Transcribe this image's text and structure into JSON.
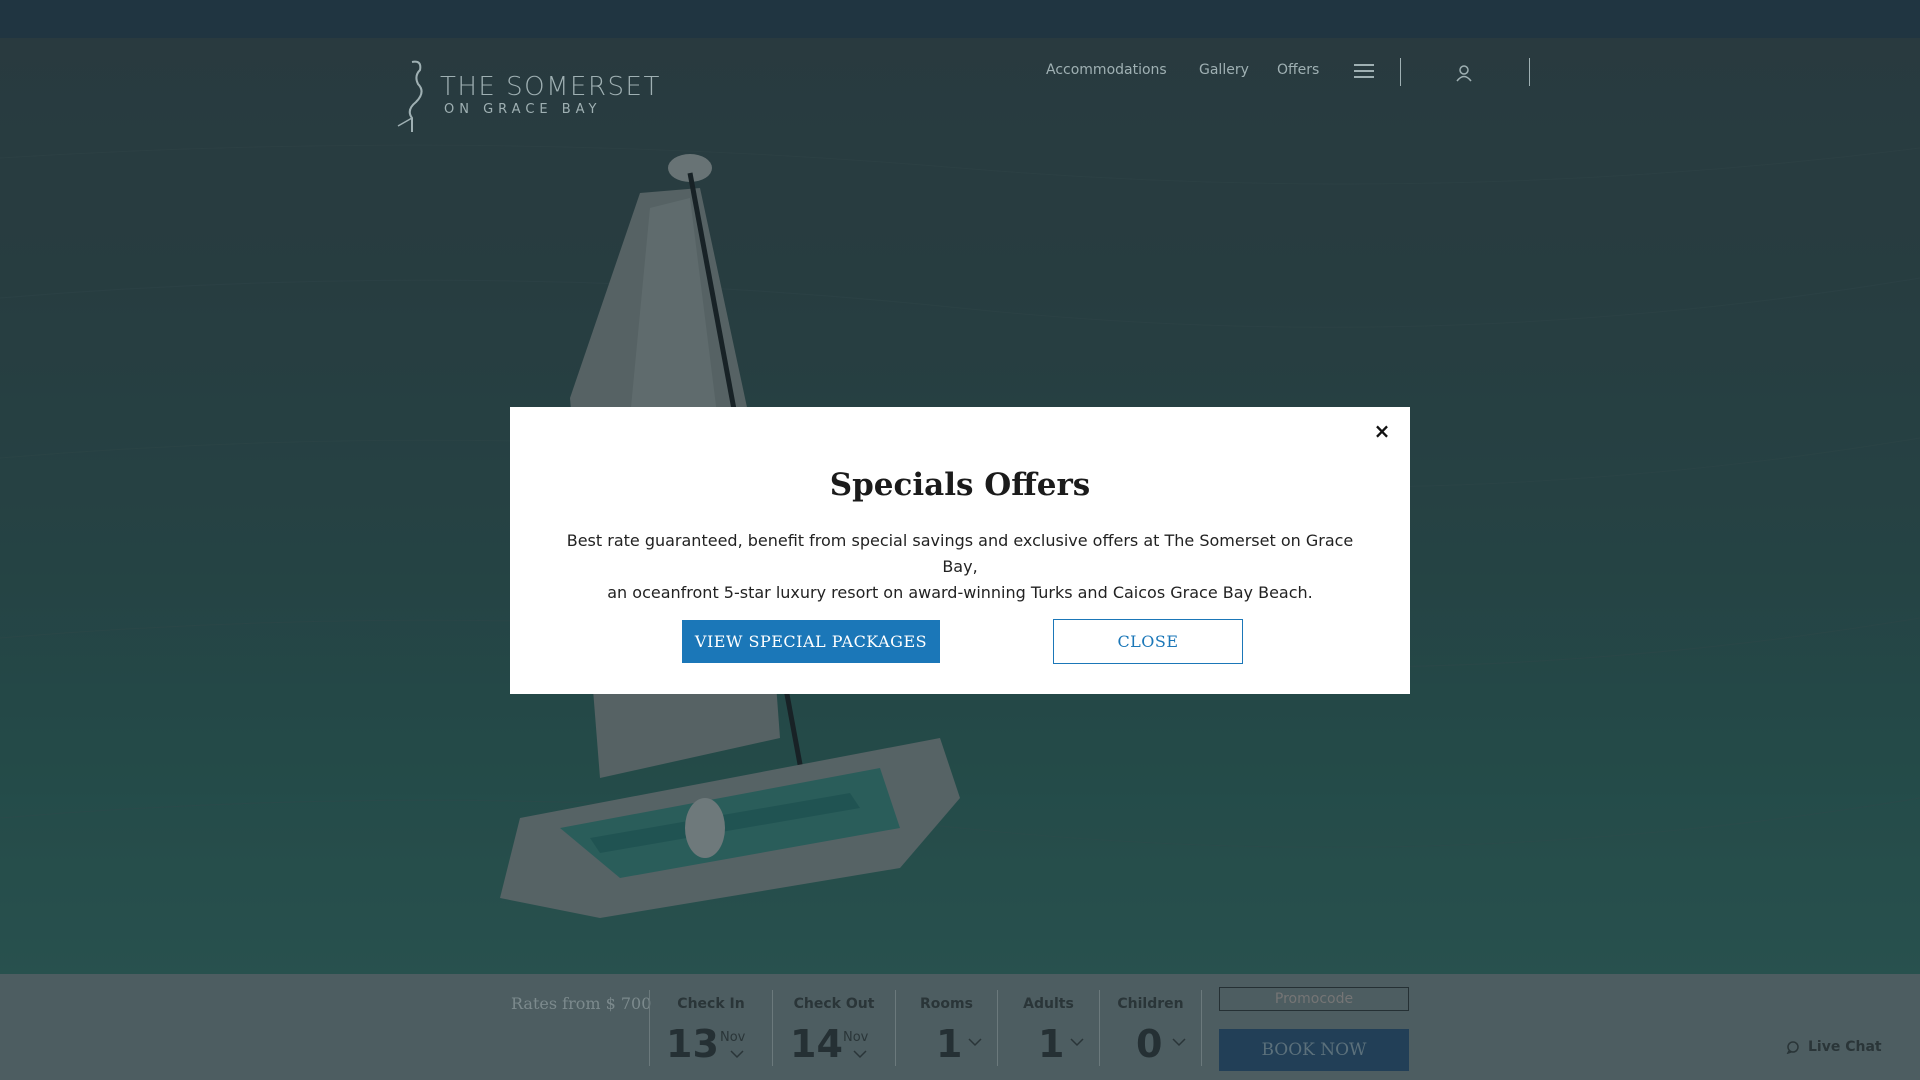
{
  "header": {
    "logo_title": "THE SOMERSET",
    "logo_subtitle": "ON GRACE BAY",
    "nav": [
      "Accommodations",
      "Gallery",
      "Offers"
    ],
    "menu_icon": "hamburger-menu-icon",
    "user_icon": "user-icon"
  },
  "modal": {
    "title": "Specials Offers",
    "body_line1": "Best rate guaranteed, benefit from special savings and exclusive offers at The Somerset on Grace Bay,",
    "body_line2": "an oceanfront 5-star luxury resort on award-winning Turks and Caicos Grace Bay Beach.",
    "primary_button": "VIEW SPECIAL PACKAGES",
    "secondary_button": "CLOSE",
    "close_icon": "×"
  },
  "booking": {
    "rates": "Rates from $ 700",
    "check_in": {
      "label": "Check In",
      "day": "13",
      "month": "Nov"
    },
    "check_out": {
      "label": "Check Out",
      "day": "14",
      "month": "Nov"
    },
    "rooms": {
      "label": "Rooms",
      "value": "1"
    },
    "adults": {
      "label": "Adults",
      "value": "1"
    },
    "children": {
      "label": "Children",
      "value": "0"
    },
    "promocode_placeholder": "Promocode",
    "book_now": "BOOK NOW"
  },
  "live_chat": "Live Chat",
  "colors": {
    "accent": "#1b77b8",
    "booking_bar": "#4d5d61",
    "top_bar": "#2e4a5a"
  }
}
